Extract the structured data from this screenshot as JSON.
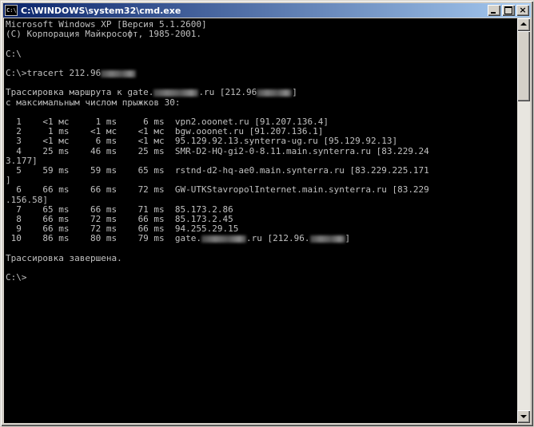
{
  "window": {
    "title": "C:\\WINDOWS\\system32\\cmd.exe",
    "icon": "cmd-icon",
    "icon_glyph": "C:\\",
    "buttons": {
      "minimize": "minimize-icon",
      "maximize": "maximize-icon",
      "close": "close-icon",
      "close_glyph": "×"
    }
  },
  "console": {
    "header1": "Microsoft Windows XP [Версия 5.1.2600]",
    "header2": "(С) Корпорация Майкрософт, 1985-2001.",
    "prompt1": "C:\\",
    "command_prefix": "C:\\>tracert 212.96",
    "trace_line_prefix": "Трассировка маршрута к gate.",
    "trace_line_mid": ".ru [212.96",
    "trace_line_suffix": "]",
    "max_hops_line": "с максимальным числом прыжков 30:",
    "hops": [
      {
        "text": "  1    <1 мс     1 ms     6 ms  vpn2.ooonet.ru [91.207.136.4]"
      },
      {
        "text": "  2     1 ms    <1 мс    <1 мс  bgw.ooonet.ru [91.207.136.1]"
      },
      {
        "text": "  3    <1 мс     6 ms    <1 мс  95.129.92.13.synterra-ug.ru [95.129.92.13]"
      },
      {
        "text": "  4    25 ms    46 ms    25 ms  SMR-D2-HQ-gi2-0-8.11.main.synterra.ru [83.229.24"
      },
      {
        "text": "3.177]"
      },
      {
        "text": "  5    59 ms    59 ms    65 ms  rstnd-d2-hq-ae0.main.synterra.ru [83.229.225.171"
      },
      {
        "text": "]"
      },
      {
        "text": "  6    66 ms    66 ms    72 ms  GW-UTKStavropolInternet.main.synterra.ru [83.229"
      },
      {
        "text": ".156.58]"
      },
      {
        "text": "  7    65 ms    66 ms    71 ms  85.173.2.86"
      },
      {
        "text": "  8    66 ms    72 ms    66 ms  85.173.2.45"
      },
      {
        "text": "  9    66 ms    72 ms    66 ms  94.255.29.15"
      }
    ],
    "hop10_prefix": " 10    86 ms    80 ms    79 ms  gate.",
    "hop10_mid": ".ru [212.96.",
    "hop10_suffix": "]",
    "trace_done": "Трассировка завершена.",
    "final_prompt": "C:\\>"
  },
  "colors": {
    "console_bg": "#000000",
    "console_text": "#c0c0c0",
    "titlebar_start": "#0a246a",
    "titlebar_end": "#a6caf0"
  }
}
